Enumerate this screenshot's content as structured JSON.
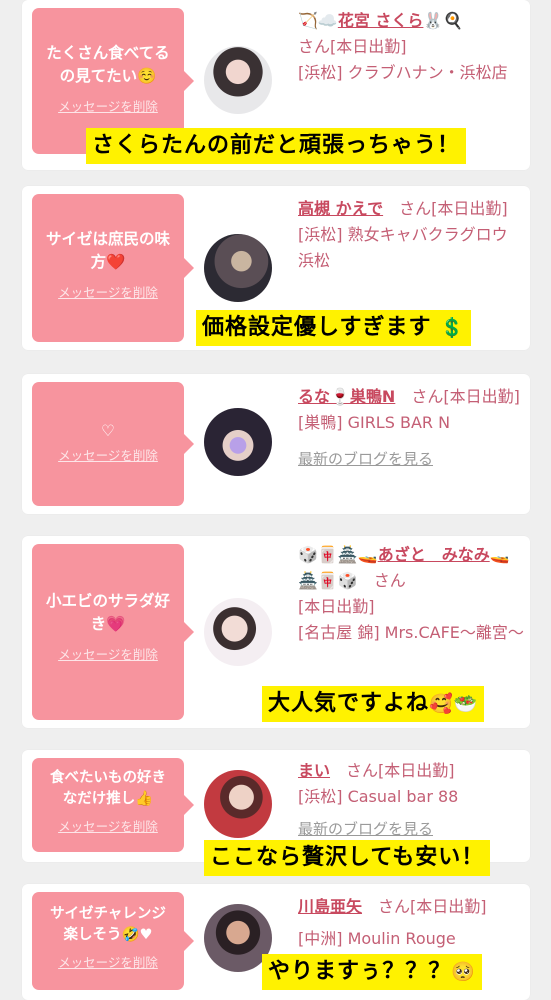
{
  "delete_label": "メッセージを削除",
  "blog_label": "最新のブログを見る",
  "colors": {
    "bubble": "#f7949e",
    "link": "#c8495f",
    "caption_bg": "#fff200"
  },
  "cards": [
    {
      "message": "たくさん食べてる\nの見てたい☺️",
      "prefix": "🏹☁️",
      "name": "花宮 さくら",
      "suffix": "🐰🍳",
      "san": "さん",
      "status": "[本日出勤]",
      "shop": "[浜松] クラブハナン・浜松店",
      "caption": "さくらたんの前だと頑張っちゃう！"
    },
    {
      "message": "サイゼは庶民の味\n方❤️",
      "name": "高槻 かえで",
      "san": "さん",
      "status": "[本日出勤]",
      "shop": "[浜松] 熟女キャバクラグロウ 浜松",
      "caption_text": "価格設定優しすぎます",
      "caption_emoji": "💲"
    },
    {
      "message": "♡",
      "name": "るな🍷巣鴨N",
      "san": "さん",
      "status": "[本日出勤]",
      "shop": "[巣鴨] GIRLS BAR N",
      "blog": "最新のブログを見る"
    },
    {
      "message": "小エビのサラダ好\nき💗",
      "prefix": "🎲🀄🏯🚤",
      "name": "あざと　みなみ",
      "suffix": "🚤🏯🀄🎲",
      "san": "さん",
      "status": "[本日出勤]",
      "shop": "[名古屋 錦] Mrs.CAFE〜離宮〜",
      "caption_text": "大人気ですよね",
      "caption_emoji": "🥰🥗"
    },
    {
      "message": "食べたいもの好き\nなだけ推し👍",
      "name": "まい",
      "san": "さん",
      "status": "[本日出勤]",
      "shop": "[浜松] Casual bar 88",
      "blog": "最新のブログを見る",
      "caption": "ここなら贅沢しても安い！"
    },
    {
      "message": "サイゼチャレンジ\n楽しそう🤣♥",
      "name": "川島亜矢",
      "san": "さん",
      "status": "[本日出勤]",
      "shop": "[中洲] Moulin Rouge",
      "caption_text": "やりますぅ？？？",
      "caption_emoji": "🥺"
    }
  ]
}
